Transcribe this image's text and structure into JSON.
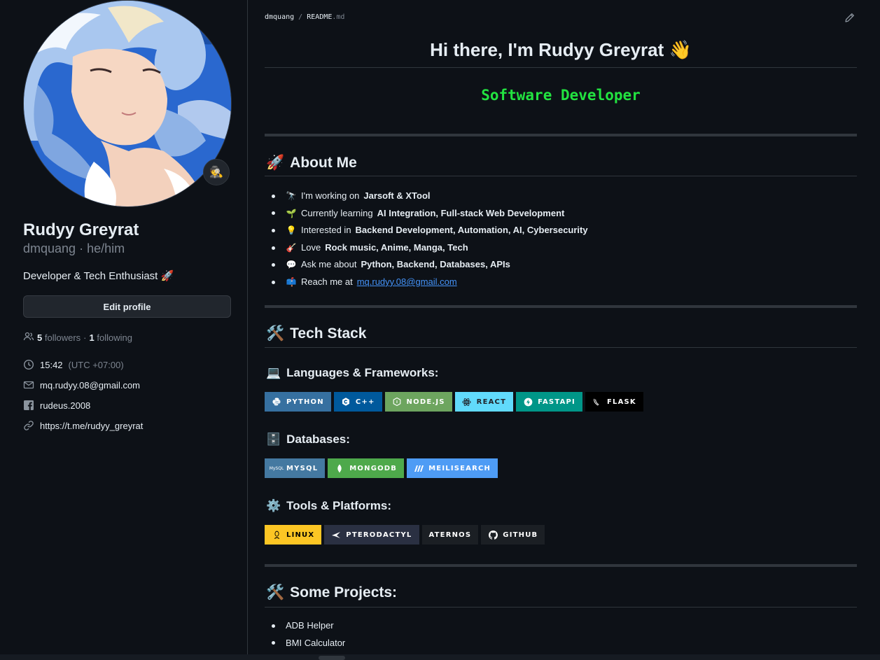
{
  "profile": {
    "name": "Rudyy Greyrat",
    "login": "dmquang",
    "pronouns": "he/him",
    "bio": "Developer & Tech Enthusiast 🚀",
    "status_emoji": "🕵",
    "edit_label": "Edit profile",
    "followers_count": "5",
    "followers_label": "followers",
    "following_count": "1",
    "following_label": "following",
    "time": "15:42",
    "timezone": "(UTC +07:00)",
    "email": "mq.rudyy.08@gmail.com",
    "facebook": "rudeus.2008",
    "link": "https://t.me/rudyy_greyrat"
  },
  "readme": {
    "breadcrumb_user": "dmquang",
    "breadcrumb_file": "README",
    "breadcrumb_ext": ".md",
    "title": "Hi there, I'm Rudyy Greyrat 👋",
    "typing_text": "Software Developer",
    "about": {
      "heading": "About Me",
      "icon": "🚀",
      "items": [
        {
          "emoji": "🔭",
          "prefix": "I'm working on ",
          "bold": "Jarsoft & XTool"
        },
        {
          "emoji": "🌱",
          "prefix": "Currently learning ",
          "bold": "AI Integration, Full-stack Web Development"
        },
        {
          "emoji": "💡",
          "prefix": "Interested in ",
          "bold": "Backend Development, Automation, AI, Cybersecurity"
        },
        {
          "emoji": "🎸",
          "prefix": "Love ",
          "bold": "Rock music, Anime, Manga, Tech"
        },
        {
          "emoji": "💬",
          "prefix": "Ask me about ",
          "bold": "Python, Backend, Databases, APIs"
        },
        {
          "emoji": "📫",
          "prefix": "Reach me at ",
          "link": "mq.rudyy.08@gmail.com"
        }
      ]
    },
    "tech": {
      "heading": "Tech Stack",
      "icon": "🛠️",
      "languages": {
        "heading": "Languages & Frameworks:",
        "icon": "💻",
        "badges": [
          {
            "label": "PYTHON",
            "icon": "python-icon",
            "color": "#3670a0"
          },
          {
            "label": "C++",
            "icon": "cpp-icon",
            "color": "#00599c"
          },
          {
            "label": "NODE.JS",
            "icon": "nodejs-icon",
            "color": "#6da55f"
          },
          {
            "label": "REACT",
            "icon": "react-icon",
            "color": "#61dafb"
          },
          {
            "label": "FASTAPI",
            "icon": "fastapi-icon",
            "color": "#009688"
          },
          {
            "label": "FLASK",
            "icon": "flask-icon",
            "color": "#000000"
          }
        ]
      },
      "databases": {
        "heading": "Databases:",
        "icon": "🗄️",
        "badges": [
          {
            "label": "MYSQL",
            "icon": "mysql-icon",
            "color": "#4479a1"
          },
          {
            "label": "MONGODB",
            "icon": "mongodb-icon",
            "color": "#4ea94b"
          },
          {
            "label": "MEILISEARCH",
            "icon": "meilisearch-icon",
            "color": "#4e9cf5"
          }
        ]
      },
      "tools": {
        "heading": "Tools & Platforms:",
        "icon": "⚙️",
        "badges": [
          {
            "label": "LINUX",
            "icon": "linux-icon",
            "color": "#fcc624"
          },
          {
            "label": "PTERODACTYL",
            "icon": "pterodactyl-icon",
            "color": "#2a3042"
          },
          {
            "label": "ATERNOS",
            "icon": "",
            "color": "#1b1f24"
          },
          {
            "label": "GITHUB",
            "icon": "github-icon",
            "color": "#1b1f24"
          }
        ]
      }
    },
    "projects": {
      "heading": "Some Projects:",
      "icon": "🛠️",
      "items": [
        "ADB Helper",
        "BMI Calculator"
      ]
    }
  }
}
